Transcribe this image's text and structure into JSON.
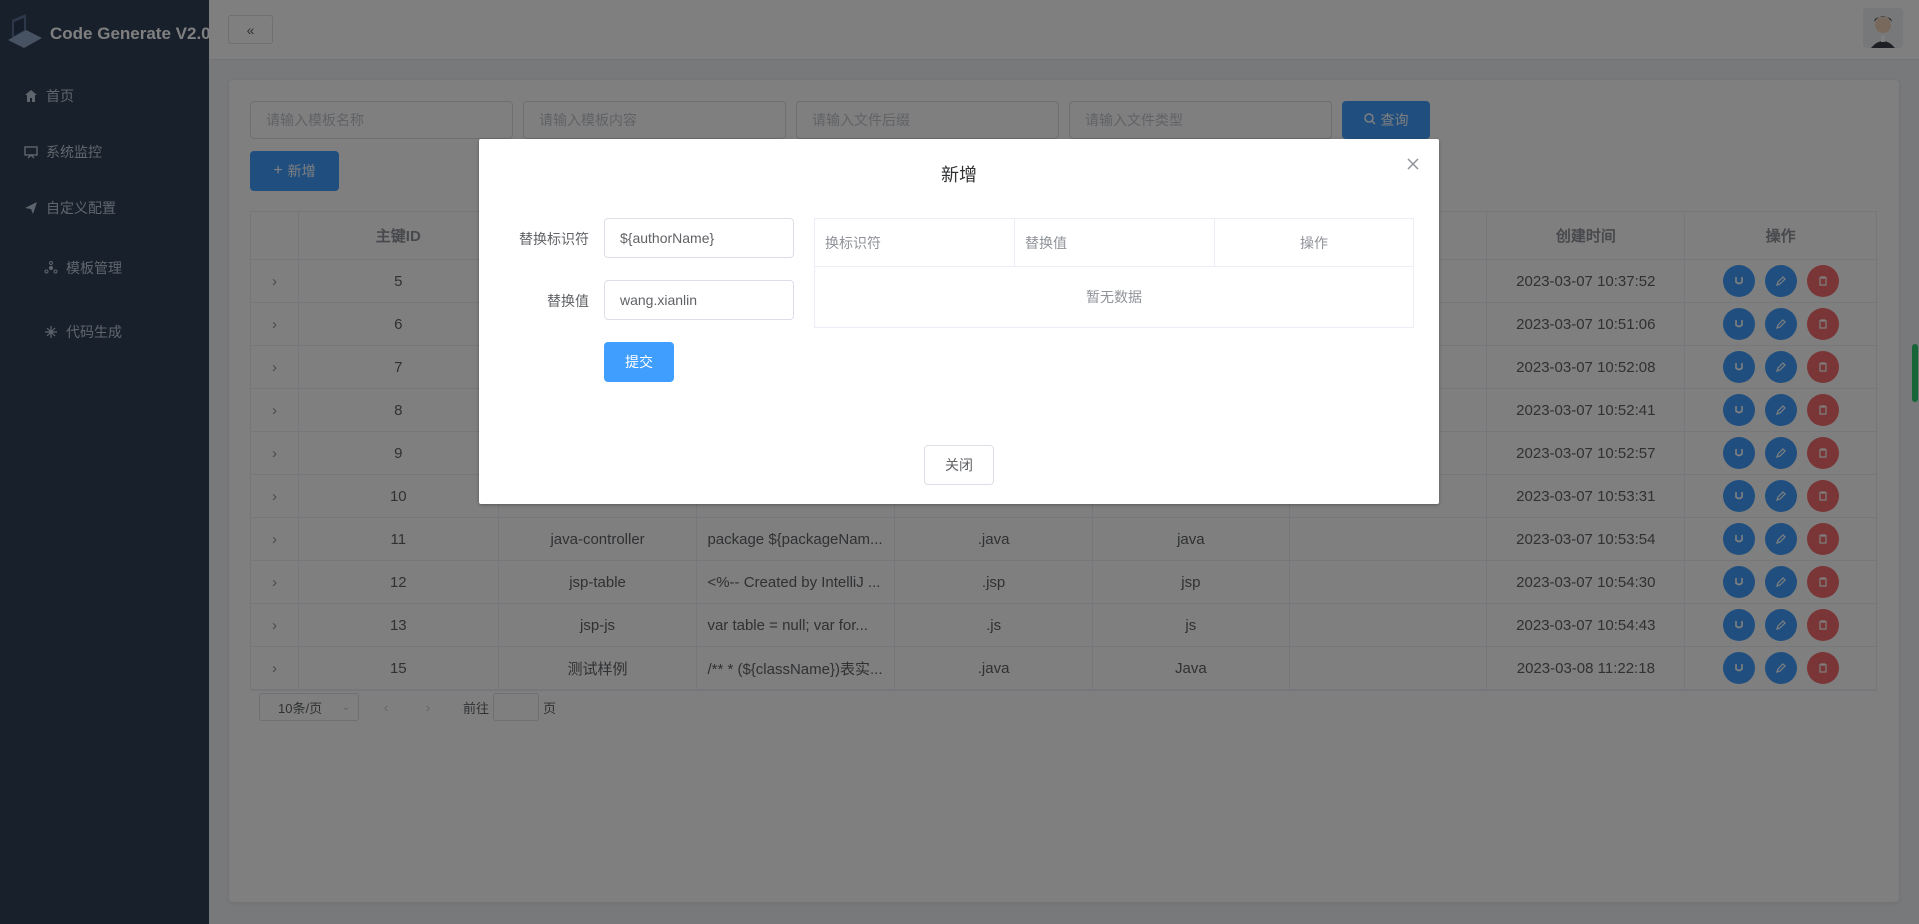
{
  "app": {
    "title": "Code Generate V2.0"
  },
  "sidebar": {
    "items": [
      {
        "label": "首页",
        "icon": "home-icon"
      },
      {
        "label": "系统监控",
        "icon": "monitor-icon"
      },
      {
        "label": "自定义配置",
        "icon": "send-icon"
      },
      {
        "label": "模板管理",
        "icon": "cluster-icon"
      },
      {
        "label": "代码生成",
        "icon": "sparkle-icon"
      }
    ]
  },
  "header": {
    "collapse_icon": "«"
  },
  "filters": {
    "template_name_placeholder": "请输入模板名称",
    "template_content_placeholder": "请输入模板内容",
    "file_suffix_placeholder": "请输入文件后缀",
    "file_type_placeholder": "请输入文件类型",
    "search_label": "查询",
    "add_label": "新增"
  },
  "table": {
    "headers": [
      "",
      "主键ID",
      "",
      "",
      "",
      "",
      "",
      "创建时间",
      "操作"
    ],
    "rows": [
      {
        "id": "5",
        "name": "",
        "content": "",
        "suffix": "",
        "type": "",
        "extra": "",
        "created": "2023-03-07 10:37:52"
      },
      {
        "id": "6",
        "name": "",
        "content": "",
        "suffix": "",
        "type": "",
        "extra": "",
        "created": "2023-03-07 10:51:06"
      },
      {
        "id": "7",
        "name": "",
        "content": "",
        "suffix": "",
        "type": "",
        "extra": "",
        "created": "2023-03-07 10:52:08"
      },
      {
        "id": "8",
        "name": "",
        "content": "",
        "suffix": "",
        "type": "",
        "extra": "",
        "created": "2023-03-07 10:52:41"
      },
      {
        "id": "9",
        "name": "",
        "content": "",
        "suffix": "",
        "type": "",
        "extra": "",
        "created": "2023-03-07 10:52:57"
      },
      {
        "id": "10",
        "name": "",
        "content": "",
        "suffix": "",
        "type": "",
        "extra": "",
        "created": "2023-03-07 10:53:31"
      },
      {
        "id": "11",
        "name": "java-controller",
        "content": "package ${packageNam...",
        "suffix": ".java",
        "type": "java",
        "extra": "",
        "created": "2023-03-07 10:53:54"
      },
      {
        "id": "12",
        "name": "jsp-table",
        "content": "<%-- Created by IntelliJ ...",
        "suffix": ".jsp",
        "type": "jsp",
        "extra": "",
        "created": "2023-03-07 10:54:30"
      },
      {
        "id": "13",
        "name": "jsp-js",
        "content": "var table = null; var for...",
        "suffix": ".js",
        "type": "js",
        "extra": "",
        "created": "2023-03-07 10:54:43"
      },
      {
        "id": "15",
        "name": "测试样例",
        "content": "/** * (${className})表实...",
        "suffix": ".java",
        "type": "Java",
        "extra": "",
        "created": "2023-03-08 11:22:18"
      }
    ]
  },
  "pagination": {
    "page_size": "10条/页",
    "goto_prefix": "前往",
    "goto_suffix": "页"
  },
  "dialog": {
    "title": "新增",
    "field1_label": "替换标识符",
    "field1_value": "${authorName}",
    "field2_label": "替换值",
    "field2_value": "wang.xianlin",
    "submit_label": "提交",
    "table_headers": [
      "换标识符",
      "替换值",
      "操作"
    ],
    "empty_text": "暂无数据",
    "close_label": "关闭"
  },
  "colors": {
    "primary": "#409eff",
    "danger": "#f56c6c",
    "sidebar_bg": "#304156"
  }
}
